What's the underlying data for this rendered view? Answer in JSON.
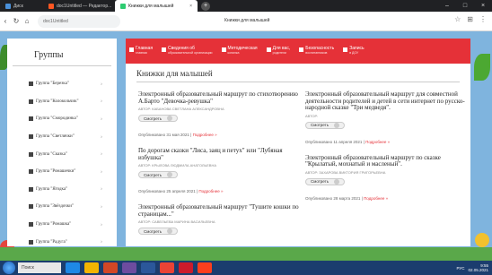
{
  "browser": {
    "tabs": [
      {
        "label": "Диск",
        "active": false,
        "color": "#4a90d9"
      },
      {
        "label": "doc1Untitled — Редактор...",
        "active": false,
        "color": "#ff5722"
      },
      {
        "label": "Книжки для малышей",
        "active": true,
        "color": "#2ecc71"
      }
    ],
    "close_glyph": "×",
    "new_tab_glyph": "+",
    "window_controls": [
      "–",
      "□",
      "×"
    ],
    "url": "doc1Untitled",
    "page_title": "Книжки для малышей",
    "nav_icons": [
      "back-icon",
      "refresh-icon",
      "home-icon"
    ]
  },
  "sidebar": {
    "title": "Группы",
    "items": [
      {
        "label": "Группа \"Березка\""
      },
      {
        "label": "Группа \"Колокольчик\""
      },
      {
        "label": "Группа \"Смородинка\""
      },
      {
        "label": "Группа \"Светлячки\""
      },
      {
        "label": "Группа \"Сказка\""
      },
      {
        "label": "Группа \"Ромашечки\""
      },
      {
        "label": "Группа \"Ягодка\""
      },
      {
        "label": "Группа \"Звёздочки\""
      },
      {
        "label": "Группа \"Ромашка\""
      },
      {
        "label": "Группа \"Радуга\""
      }
    ],
    "chevron": "›"
  },
  "menu": [
    {
      "label": "Главная",
      "sub": "главная"
    },
    {
      "label": "Сведения об",
      "sub": "образовательной организации"
    },
    {
      "label": "Методическая",
      "sub": "копилка"
    },
    {
      "label": "Для вас,",
      "sub": "родители"
    },
    {
      "label": "Безопасность",
      "sub": "воспитанников"
    },
    {
      "label": "Запись",
      "sub": "в ДОУ"
    }
  ],
  "page": {
    "heading": "Книжки для малышей",
    "more_label": "Смотреть",
    "left": [
      {
        "title": "Электронный образовательный маршрут по стихотворению А.Барто \"Девочка-ревушка\"",
        "author": "АВТОР: КАБАНОВА СВЕТЛАНА АЛЕКСАНДРОВНА",
        "date": "Опубликовано 31 мая 2021",
        "tag": "Подробнее »"
      },
      {
        "title": "По дорогам сказки \"Лиса, заяц и петух\" или \"Лубяная избушка\"",
        "author": "АВТОР: КРЫЛОВА ЛЮДМИЛА АНАТОЛЬЕВНА",
        "date": "Опубликовано 25 апреля 2021",
        "tag": "Подробнее »"
      },
      {
        "title": "Электронный образовательный маршрут \"Тушите кошки по страницам...\"",
        "author": "АВТОР: САВЕЛЬЕВА МАРИНА ВАСИЛЬЕВНА",
        "date": "",
        "tag": ""
      }
    ],
    "right": [
      {
        "title": "Электронный образовательный маршрут для совместной деятельности родителей и детей в сети интернет по русско-народной сказке \"Три медведя\".",
        "author": "АВТОР:",
        "date": "Опубликовано 11 апреля 2021",
        "tag": "Подробнее »"
      },
      {
        "title": "Электронный образовательный маршрут по сказке \"Крылатый, мохнатый и масленый\".",
        "author": "АВТОР: ЗАХАРОВА ВИКТОРИЯ ГРИГОРЬЕВНА",
        "date": "Опубликовано 28 марта 2021",
        "tag": "Подробнее »"
      }
    ]
  },
  "taskbar": {
    "search": "Поиск",
    "time": "9:55",
    "date": "02.05.2021",
    "lang": "РУС"
  }
}
